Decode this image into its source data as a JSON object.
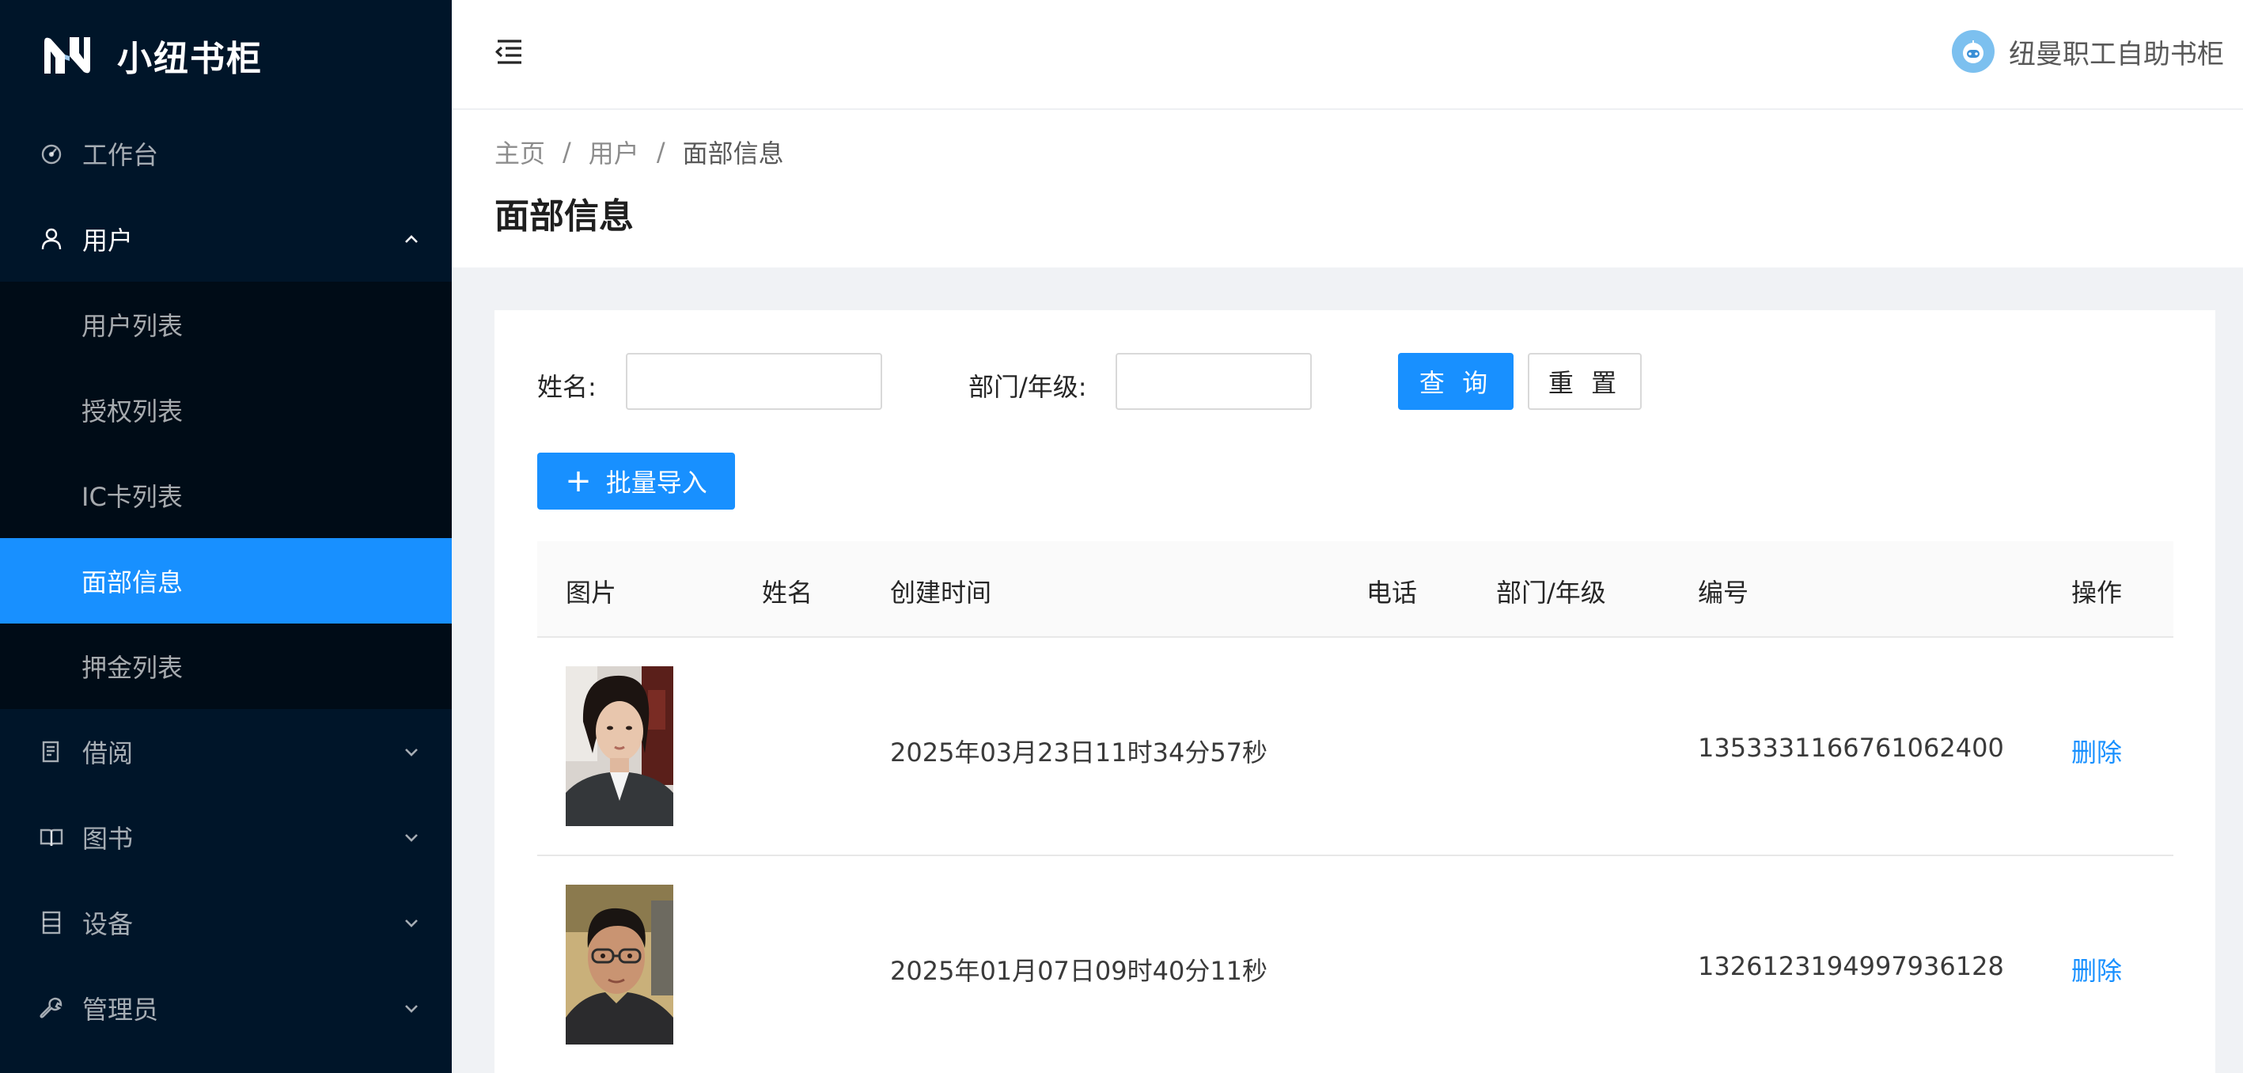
{
  "app": {
    "title": "小纽书柜"
  },
  "sidebar": {
    "items": [
      {
        "label": "工作台",
        "icon": "dashboard-icon"
      },
      {
        "label": "用户",
        "icon": "user-icon",
        "open": true,
        "children": [
          {
            "label": "用户列表"
          },
          {
            "label": "授权列表"
          },
          {
            "label": "IC卡列表"
          },
          {
            "label": "面部信息",
            "active": true
          },
          {
            "label": "押金列表"
          }
        ]
      },
      {
        "label": "借阅",
        "icon": "borrow-icon"
      },
      {
        "label": "图书",
        "icon": "book-icon"
      },
      {
        "label": "设备",
        "icon": "device-icon"
      },
      {
        "label": "管理员",
        "icon": "wrench-icon"
      }
    ]
  },
  "header": {
    "user_name": "纽曼职工自助书柜"
  },
  "breadcrumb": [
    "主页",
    "用户",
    "面部信息"
  ],
  "page_title": "面部信息",
  "search": {
    "name_label": "姓名:",
    "name_value": "",
    "dept_label": "部门/年级:",
    "dept_value": "",
    "query_label": "查 询",
    "reset_label": "重 置"
  },
  "toolbar": {
    "import_label": "批量导入"
  },
  "table": {
    "columns": [
      "图片",
      "姓名",
      "创建时间",
      "电话",
      "部门/年级",
      "编号",
      "操作"
    ],
    "rows": [
      {
        "name": "",
        "created": "2025年03月23日11时34分57秒",
        "phone": "",
        "dept": "",
        "id": "1353331166761062400",
        "action": "删除"
      },
      {
        "name": "",
        "created": "2025年01月07日09时40分11秒",
        "phone": "",
        "dept": "",
        "id": "1326123194997936128",
        "action": "删除"
      }
    ]
  },
  "colors": {
    "sidebar_bg": "#001529",
    "submenu_bg": "#000c17",
    "primary": "#1890ff"
  }
}
